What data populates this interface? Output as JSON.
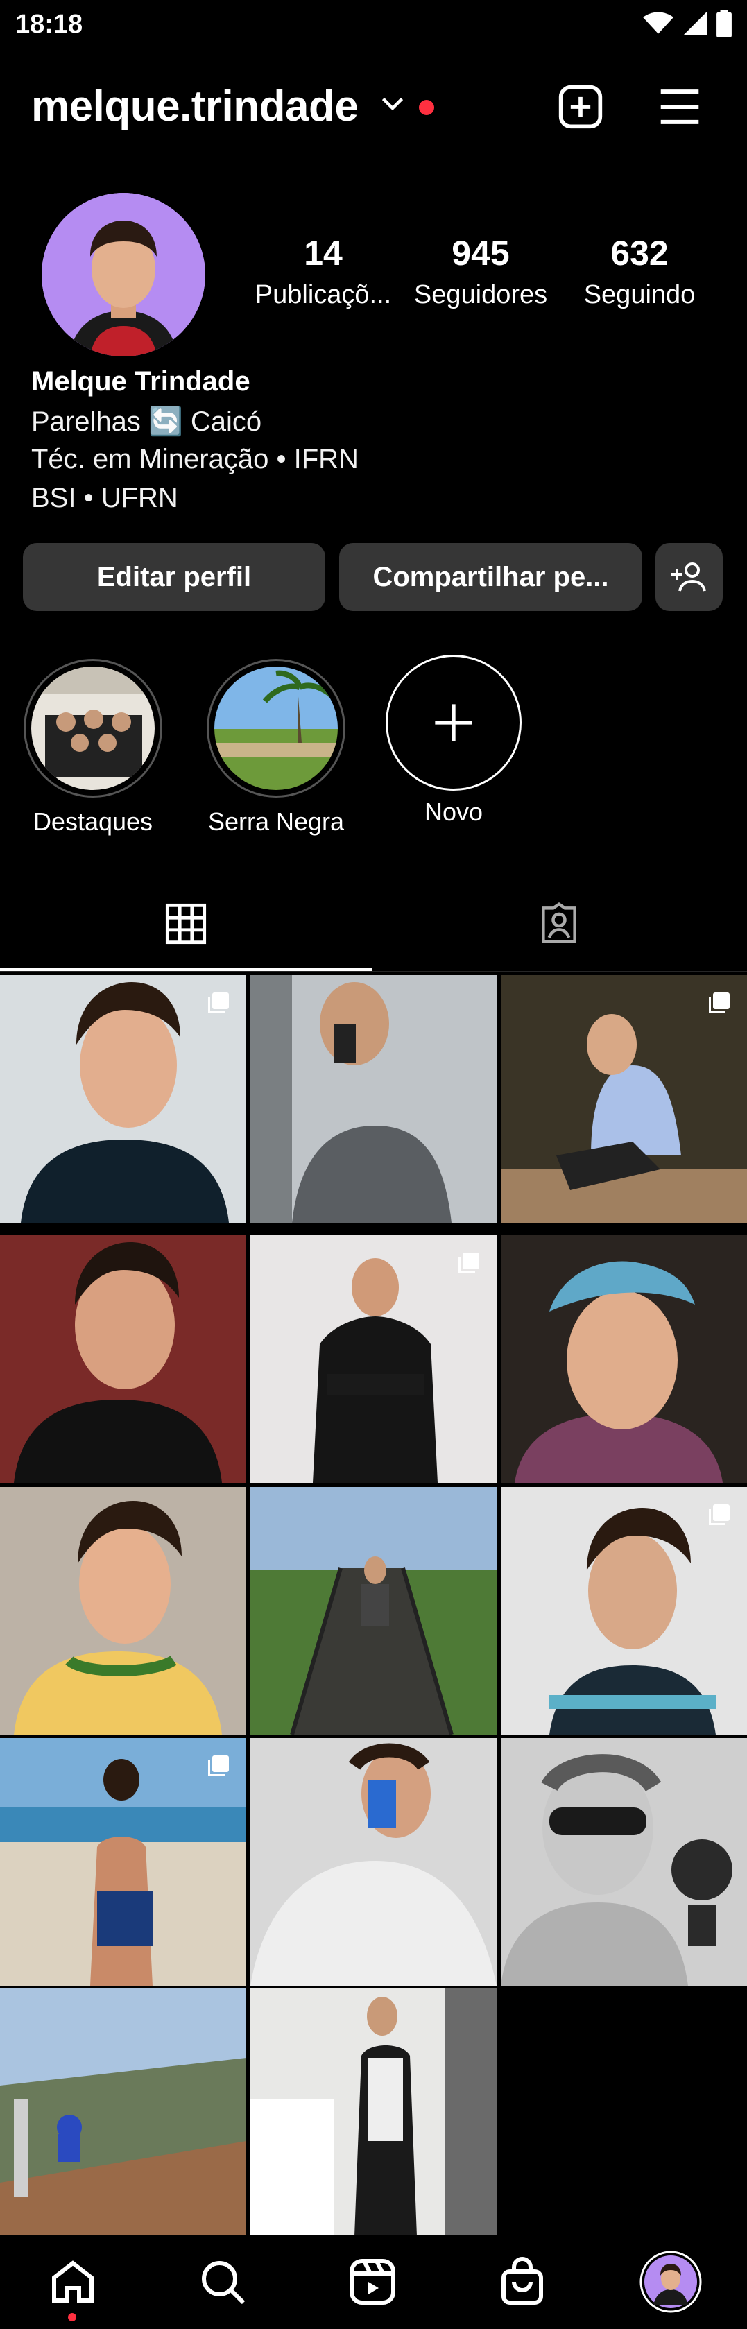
{
  "status": {
    "time": "18:18"
  },
  "header": {
    "username": "melque.trindade"
  },
  "stats": [
    {
      "value": "14",
      "label": "Publicaçõ..."
    },
    {
      "value": "945",
      "label": "Seguidores"
    },
    {
      "value": "632",
      "label": "Seguindo"
    }
  ],
  "bio": {
    "name": "Melque Trindade",
    "line1": "Parelhas 🔄 Caicó",
    "line2": "Téc. em Mineração • IFRN",
    "line3": "BSI • UFRN"
  },
  "buttons": {
    "edit": "Editar perfil",
    "share": "Compartilhar pe..."
  },
  "highlights": [
    {
      "label": "Destaques"
    },
    {
      "label": "Serra Negra"
    },
    {
      "label": "Novo"
    }
  ],
  "colors": {
    "accent": "#ff3040",
    "button_bg": "#363636",
    "background": "#000000"
  }
}
